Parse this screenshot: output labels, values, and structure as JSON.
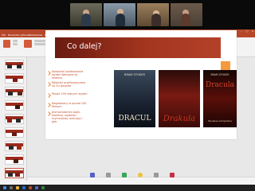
{
  "ppt": {
    "title": "Prezentacja Stereotypy drakuli - PowerPoint",
    "user": "Hubert Sobczak",
    "tabs": [
      "Plik",
      "Narzędzia główne",
      "Wstawianie",
      "Projektowanie",
      "Przejścia",
      "Animacje",
      "Pokaz slajdów",
      "Recenzja",
      "Widok",
      "Pomoc",
      "Powiedz mi, co chcesz zrobić"
    ],
    "share_label": "Udostępnij"
  },
  "slide": {
    "title": "Co dalej?",
    "bullets": [
      "Kolejność publikowania wydań Wampira ze Stokera",
      "Również przetłumaczona na 30 języków",
      "Ponad 100 różnych wydań",
      "Nagrodzony w ponad 100 filmach",
      "Jest bohaterem bajki, komiksu, powieści kryminalnej, animacji i gier"
    ],
    "books": [
      {
        "author": "BRAM STOKER",
        "title": "DRACUL"
      },
      {
        "author": "",
        "title": "Drakula"
      },
      {
        "author": "BRAM STOKER",
        "title": "Dracula",
        "subtitle": "Wydanie kompletne"
      }
    ]
  },
  "controls": [
    {
      "label": "Pokaż",
      "icon": "share-screen-icon"
    },
    {
      "label": "Rozmowa",
      "icon": "chat-icon"
    },
    {
      "label": "Uczestnicy",
      "icon": "people-icon"
    },
    {
      "label": "Reakcje",
      "icon": "reactions-icon"
    },
    {
      "label": "Wycisz",
      "icon": "mic-icon"
    },
    {
      "label": "Opuść",
      "icon": "leave-icon"
    }
  ],
  "colors": {
    "ppt_accent": "#b7472a",
    "slide_band": "#a4351f",
    "accent_orange": "#f49a3c"
  }
}
